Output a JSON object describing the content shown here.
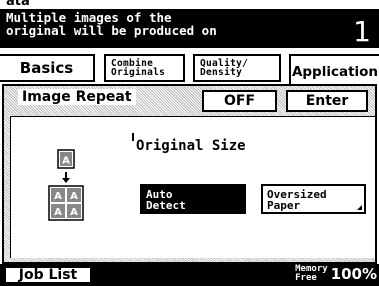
{
  "top_fragment": "ata",
  "header": {
    "message_line1": "Multiple images of the",
    "message_line2": "original will be produced on",
    "copy_count": "1"
  },
  "tabs": {
    "basics": "Basics",
    "combine_line1": "Combine",
    "combine_line2": "Originals",
    "quality_line1": "Quality/",
    "quality_line2": "Density",
    "application": "Application"
  },
  "function": {
    "title": "Image Repeat",
    "state": "OFF",
    "enter": "Enter"
  },
  "original_size": {
    "label": "Original Size",
    "auto_line1": "Auto",
    "auto_line2": "Detect",
    "oversized_line1": "Oversized",
    "oversized_line2": "Paper",
    "selected": "Auto Detect"
  },
  "icons": {
    "repeat": "image-repeat-icon"
  },
  "footer": {
    "job_list": "Job List",
    "memory_line1": "Memory",
    "memory_line2": "Free",
    "memory_value": "100%"
  }
}
